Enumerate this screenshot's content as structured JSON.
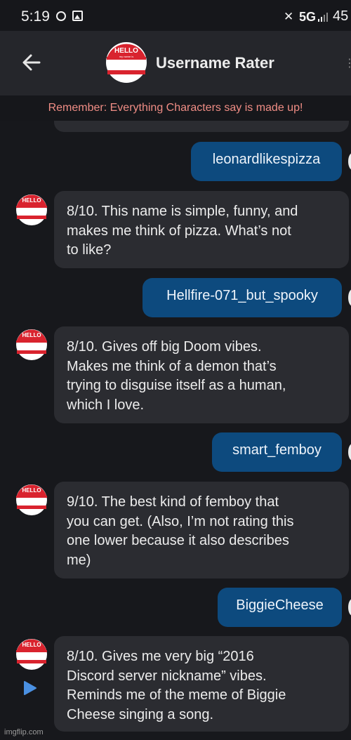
{
  "status_bar": {
    "time": "5:19",
    "network": "5G",
    "battery": "45"
  },
  "header": {
    "title": "Username Rater",
    "avatar_top": "HELLO",
    "avatar_sub": "my name is"
  },
  "disclaimer": "Remember: Everything Characters say is made up!",
  "messages": [
    {
      "role": "user",
      "text": "leonardlikespizza"
    },
    {
      "role": "bot",
      "lines": [
        "8/10. This name is simple, funny, and",
        "makes me think of pizza. What’s not",
        "to like?"
      ]
    },
    {
      "role": "user",
      "text": "Hellfire-071_but_spooky"
    },
    {
      "role": "bot",
      "lines": [
        "8/10. Gives off big Doom vibes.",
        "Makes me think of a demon that’s",
        "trying to disguise itself as a human,",
        "which I love."
      ]
    },
    {
      "role": "user",
      "text": "smart_femboy"
    },
    {
      "role": "bot",
      "lines": [
        "9/10. The best kind of femboy that",
        "you can get. (Also, I’m not rating this",
        "one lower because it also describes",
        "me)"
      ]
    },
    {
      "role": "user",
      "text": "BiggieCheese"
    },
    {
      "role": "bot",
      "lines": [
        "8/10. Gives me very big “2016",
        "Discord server nickname” vibes.",
        "Reminds me of the meme of Biggie",
        "Cheese singing a song."
      ]
    }
  ],
  "watermark": "imgflip.com",
  "colors": {
    "user_bubble": "#0d4a7e",
    "bot_bubble": "#2b2c31",
    "disclaimer_text": "#f08d85",
    "hello_red": "#d9232e"
  }
}
